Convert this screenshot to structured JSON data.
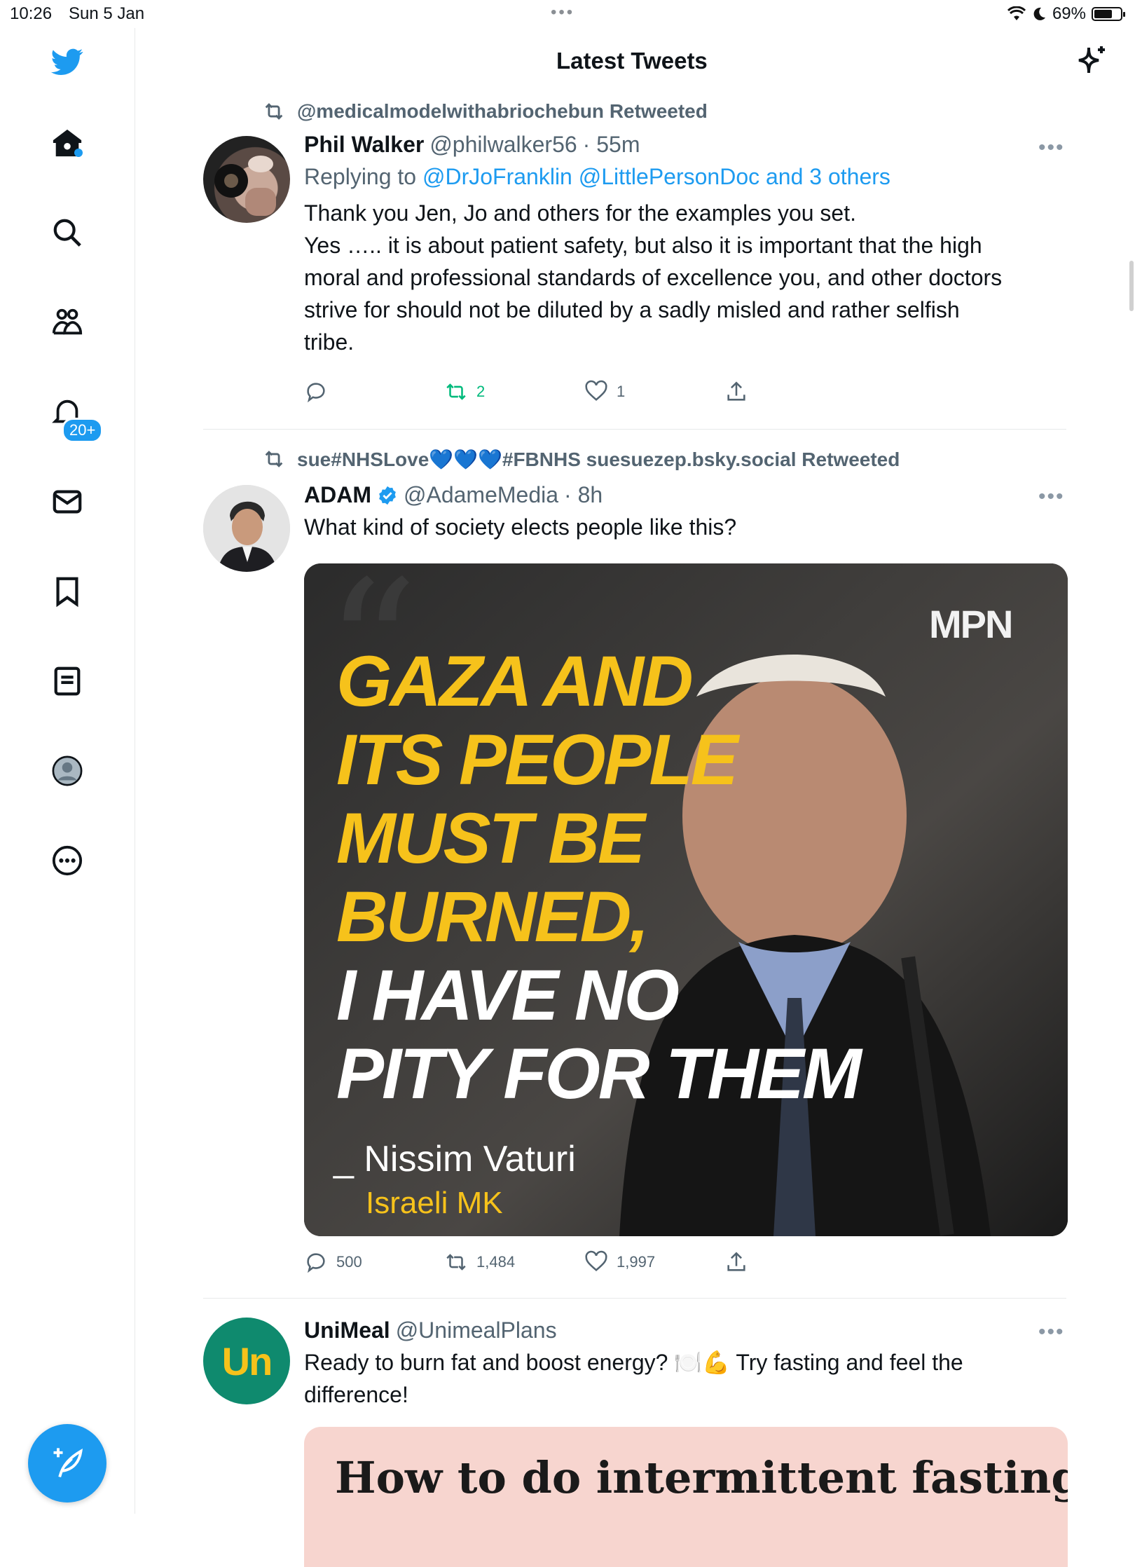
{
  "status": {
    "time": "10:26",
    "date": "Sun 5 Jan",
    "dots": "•••",
    "battery": "69%",
    "battery_level": 0.69
  },
  "sidebar": {
    "notifications_badge": "20+",
    "icons": [
      "twitter-bird-icon",
      "home-icon",
      "search-icon",
      "communities-icon",
      "notifications-icon",
      "messages-icon",
      "bookmarks-icon",
      "lists-icon",
      "profile-icon",
      "more-icon"
    ]
  },
  "header": {
    "title": "Latest Tweets"
  },
  "tweets": [
    {
      "retweeted_by": "@medicalmodelwithabriochebun Retweeted",
      "name": "Phil Walker",
      "handle": "@philwalker56",
      "time": "· 55m",
      "replying_prefix": "Replying to ",
      "replying_to": "@DrJoFranklin @LittlePersonDoc and 3 others",
      "text_lines": [
        "Thank you Jen, Jo and others for the examples you set.",
        "Yes ….. it is about patient safety, but also it is important that the high",
        "moral and professional standards of excellence you, and other doctors",
        "strive for should not be diluted by a sadly misled and rather selfish",
        "tribe."
      ],
      "replies": "",
      "retweets": "2",
      "likes": "1"
    },
    {
      "retweeted_by": "sue#NHSLove💙💙💙#FBNHS suesuezep.bsky.social Retweeted",
      "name": "ADAM",
      "handle": "@AdameMedia",
      "time": "· 8h",
      "text": "What kind of society elects people like this?",
      "media": {
        "logo": "MPN",
        "yellow_lines": [
          "GAZA AND",
          "ITS PEOPLE",
          "MUST BE",
          "BURNED,"
        ],
        "white_lines": [
          "I HAVE NO",
          "PITY FOR THEM"
        ],
        "attribution": "_ Nissim Vaturi",
        "attribution_role": "Israeli MK"
      },
      "replies": "500",
      "retweets": "1,484",
      "likes": "1,997"
    },
    {
      "name": "UniMeal",
      "handle": "@UnimealPlans",
      "avatar_text": "Un",
      "text_line1": "Ready to burn fat and boost energy? 🍽️💪 Try fasting and feel the",
      "text_line2": "difference!",
      "media_title": "How to do intermittent fasting"
    }
  ],
  "colors": {
    "accent": "#1d9bf0",
    "retweet_green": "#00ba7c",
    "muted": "#536471",
    "unimeal_green": "#0f8a6e"
  }
}
